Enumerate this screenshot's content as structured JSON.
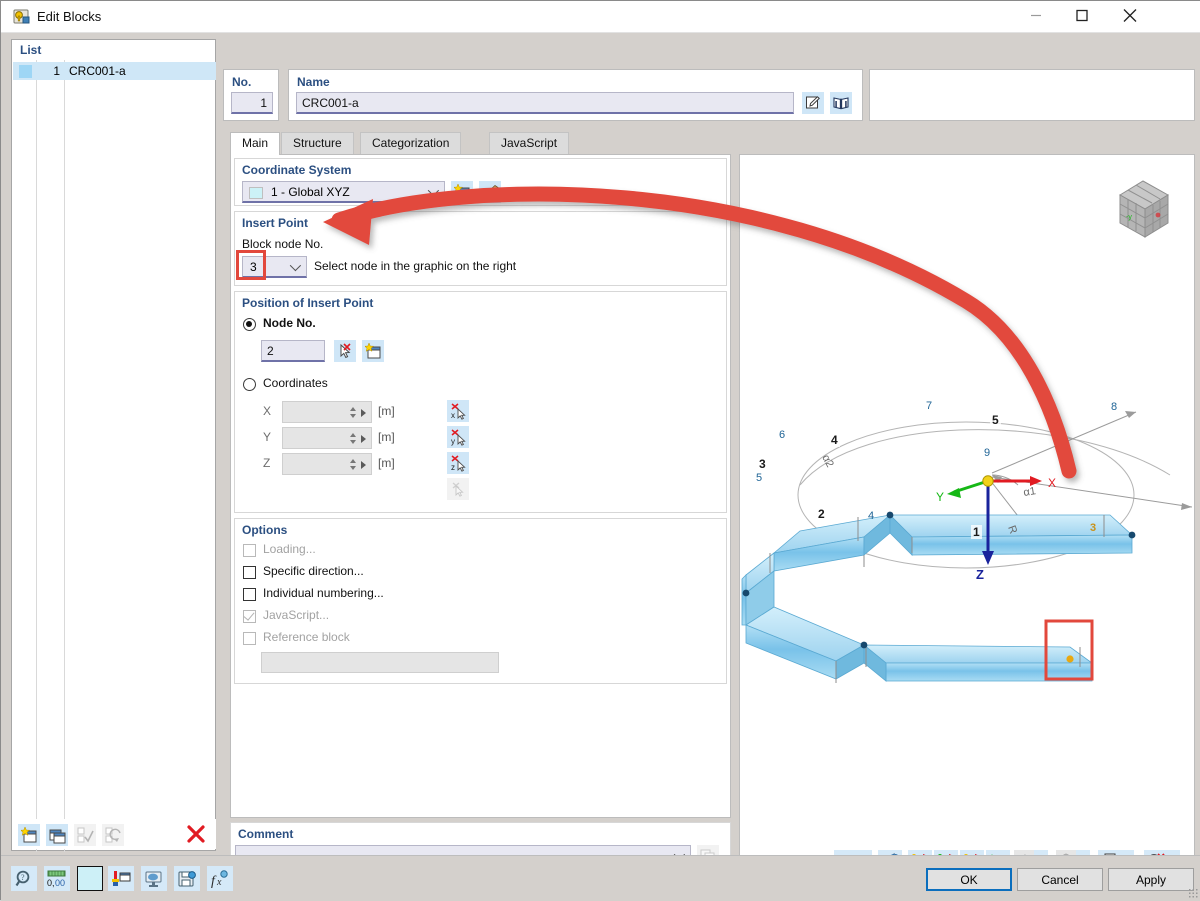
{
  "window": {
    "title": "Edit Blocks",
    "icon": "app-icon",
    "minimize": "–",
    "maximize": "□",
    "close": "✕"
  },
  "list": {
    "header": "List",
    "rows": [
      {
        "no": "1",
        "name": "CRC001-a"
      }
    ],
    "tools": [
      {
        "name": "new-block-icon",
        "enabled": true
      },
      {
        "name": "copy-block-icon",
        "enabled": true
      },
      {
        "name": "select-all-icon",
        "enabled": false
      },
      {
        "name": "invert-selection-icon",
        "enabled": false
      },
      {
        "name": "delete-icon",
        "enabled": true
      }
    ]
  },
  "header": {
    "no_label": "No.",
    "no_value": "1",
    "name_label": "Name",
    "name_value": "CRC001-a",
    "name_edit_icon": "edit-pencil-icon",
    "name_library_icon": "library-book-icon"
  },
  "tabs": [
    {
      "label": "Main",
      "selected": true
    },
    {
      "label": "Structure",
      "selected": false
    },
    {
      "label": "Categorization",
      "selected": false
    },
    {
      "label": "JavaScript",
      "selected": false
    }
  ],
  "coordinate_system": {
    "title": "Coordinate System",
    "value": "1 - Global XYZ",
    "new_icon": "new-coordinate-system-icon",
    "edit_icon": "edit-coordinate-system-icon"
  },
  "insert_point": {
    "title": "Insert Point",
    "block_node_label": "Block node No.",
    "block_node_value": "3",
    "hint": "Select node in the graphic on the right"
  },
  "position": {
    "title": "Position of Insert Point",
    "mode_node_label": "Node No.",
    "mode_node_selected": true,
    "node_value": "2",
    "pick_node_icon": "pick-node-cursor-icon",
    "new_node_icon": "new-node-icon",
    "mode_coordinates_label": "Coordinates",
    "mode_coordinates_selected": false,
    "coords": [
      {
        "axis": "X",
        "value": "",
        "unit": "[m]",
        "pick_icon": "pick-x-icon"
      },
      {
        "axis": "Y",
        "value": "",
        "unit": "[m]",
        "pick_icon": "pick-y-icon"
      },
      {
        "axis": "Z",
        "value": "",
        "unit": "[m]",
        "pick_icon": "pick-z-icon"
      }
    ],
    "extra_pick_icon": "pick-point-icon"
  },
  "options": {
    "title": "Options",
    "items": [
      {
        "label": "Loading...",
        "checked": false,
        "enabled": false
      },
      {
        "label": "Specific direction...",
        "checked": false,
        "enabled": true
      },
      {
        "label": "Individual numbering...",
        "checked": false,
        "enabled": true
      },
      {
        "label": "JavaScript...",
        "checked": true,
        "enabled": false
      },
      {
        "label": "Reference block",
        "checked": false,
        "enabled": false
      }
    ],
    "reference_value": ""
  },
  "comment": {
    "title": "Comment",
    "value": "",
    "copy_icon": "copy-comment-icon"
  },
  "graphic": {
    "nav_cube_icon": "view-cube-icon",
    "members": [
      "1",
      "2",
      "3",
      "4",
      "5"
    ],
    "nodes": [
      "3",
      "4",
      "5",
      "6",
      "7",
      "8",
      "9"
    ],
    "highlighted_node": "3",
    "axes": {
      "x": "X",
      "y": "Y",
      "z": "Z"
    },
    "angles": [
      "α1",
      "α2"
    ],
    "radius_label": "R",
    "toolbar": [
      {
        "name": "numbering-icon",
        "dropdown": true,
        "enabled": true
      },
      {
        "name": "dimensions-icon",
        "dropdown": false,
        "enabled": true
      },
      {
        "name": "view-x-icon",
        "dropdown": false,
        "enabled": true
      },
      {
        "name": "view-negy-icon",
        "dropdown": false,
        "enabled": true
      },
      {
        "name": "view-z-icon",
        "dropdown": false,
        "enabled": true
      },
      {
        "name": "view-isometric-icon",
        "dropdown": false,
        "enabled": true
      },
      {
        "name": "render-mode-icon",
        "dropdown": true,
        "enabled": false
      },
      {
        "name": "wireframe-icon",
        "dropdown": true,
        "enabled": false
      },
      {
        "name": "print-icon",
        "dropdown": true,
        "enabled": true
      },
      {
        "name": "zoom-reset-icon",
        "dropdown": true,
        "enabled": true
      }
    ]
  },
  "status_tools": [
    {
      "name": "help-search-icon"
    },
    {
      "name": "decimal-places-icon"
    },
    {
      "name": "color-swatch-icon"
    },
    {
      "name": "display-properties-icon"
    },
    {
      "name": "render-settings-icon"
    },
    {
      "name": "save-settings-icon"
    },
    {
      "name": "function-icon"
    }
  ],
  "footer": {
    "ok": "OK",
    "cancel": "Cancel",
    "apply": "Apply"
  },
  "annotation": {
    "arrow_color": "#e2483c",
    "highlight_color": "#e2483c"
  },
  "colors": {
    "accent": "#2b4f81",
    "field_bg": "#e8e8f2",
    "selection": "#cfe7f7",
    "member_blue": "#7fc4e8"
  }
}
